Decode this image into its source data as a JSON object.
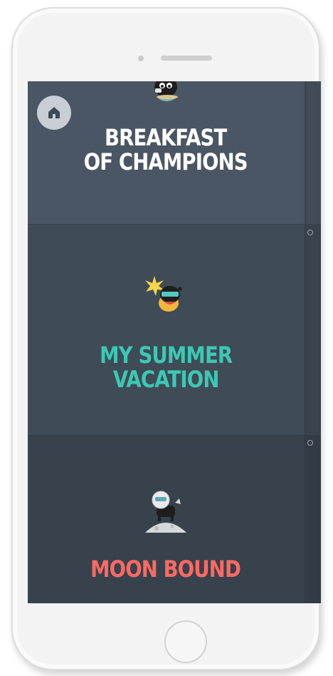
{
  "screen": {
    "home_button": {
      "icon": "home-icon"
    },
    "cards": [
      {
        "title_line1": "BREAKFAST",
        "title_line2": "OF CHAMPIONS",
        "color": "#ffffff",
        "icon": "cow-with-bowl-icon"
      },
      {
        "title_line1": "MY SUMMER",
        "title_line2": "VACATION",
        "color": "#3cc9b3",
        "icon": "cow-with-sunglasses-icon"
      },
      {
        "title_line1": "MOON BOUND",
        "title_line2": "",
        "color": "#ff6a63",
        "icon": "astronaut-cow-icon"
      }
    ]
  },
  "device": {
    "color": "#f3f3f3",
    "screen_color": "#3d4955"
  }
}
